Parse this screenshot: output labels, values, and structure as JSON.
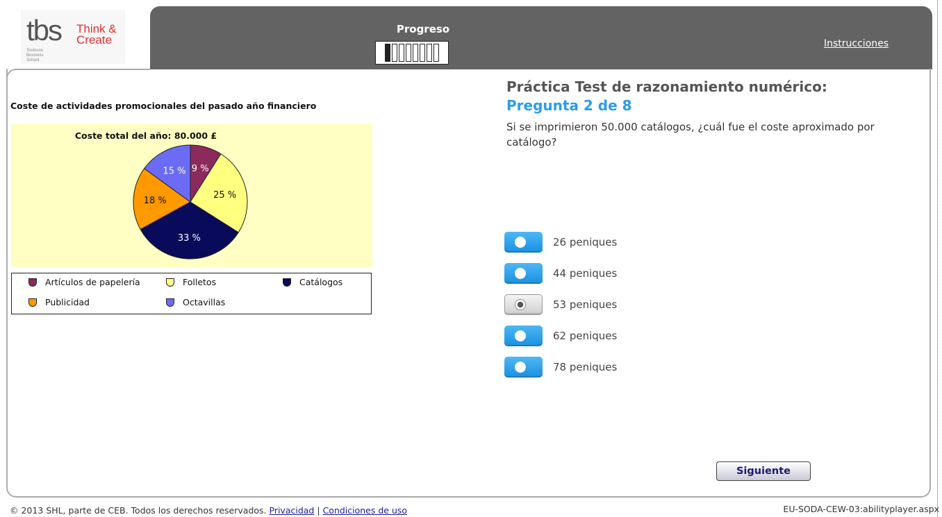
{
  "logo": {
    "brand": "tbs",
    "tagline": "Think & Create",
    "sub": "Toulouse Business School"
  },
  "header": {
    "progress_label": "Progreso",
    "progress": {
      "completed": 1,
      "total": 8
    },
    "instructions_link": "Instrucciones"
  },
  "chart_section": {
    "title": "Coste de actividades promocionales del pasado año financiero"
  },
  "chart_data": {
    "type": "pie",
    "title": "Coste total del año: 80.000 £",
    "slices": [
      {
        "label": "Artículos de papelería",
        "value": 9,
        "display": "9 %",
        "color": "#8b2a5b"
      },
      {
        "label": "Folletos",
        "value": 25,
        "display": "25 %",
        "color": "#ffff80"
      },
      {
        "label": "Catálogos",
        "value": 33,
        "display": "33 %",
        "color": "#0a0a5a"
      },
      {
        "label": "Publicidad",
        "value": 18,
        "display": "18 %",
        "color": "#ff9900"
      },
      {
        "label": "Octavillas",
        "value": 15,
        "display": "15 %",
        "color": "#6b6bf5"
      }
    ],
    "legend": [
      {
        "label": "Artículos de papelería",
        "color": "#8b2a5b"
      },
      {
        "label": "Folletos",
        "color": "#ffff80"
      },
      {
        "label": "Catálogos",
        "color": "#0a0a5a"
      },
      {
        "label": "Publicidad",
        "color": "#ff9900"
      },
      {
        "label": "Octavillas",
        "color": "#6b6bf5"
      }
    ]
  },
  "question": {
    "header": "Práctica Test de razonamiento numérico:",
    "number": "Pregunta 2 de 8",
    "text": "Si se imprimieron 50.000 catálogos, ¿cuál fue el coste aproximado por catálogo?",
    "options": [
      {
        "label": "26 peniques",
        "selected": false
      },
      {
        "label": "44 peniques",
        "selected": false
      },
      {
        "label": "53 peniques",
        "selected": true
      },
      {
        "label": "62 peniques",
        "selected": false
      },
      {
        "label": "78 peniques",
        "selected": false
      }
    ],
    "next_label": "Siguiente"
  },
  "footer": {
    "copyright": "© 2013 SHL, parte de CEB. Todos los derechos reservados.",
    "privacy": "Privacidad",
    "separator": "|",
    "terms": "Condiciones de uso",
    "page_id": "EU-SODA-CEW-03:abilityplayer.aspx"
  }
}
